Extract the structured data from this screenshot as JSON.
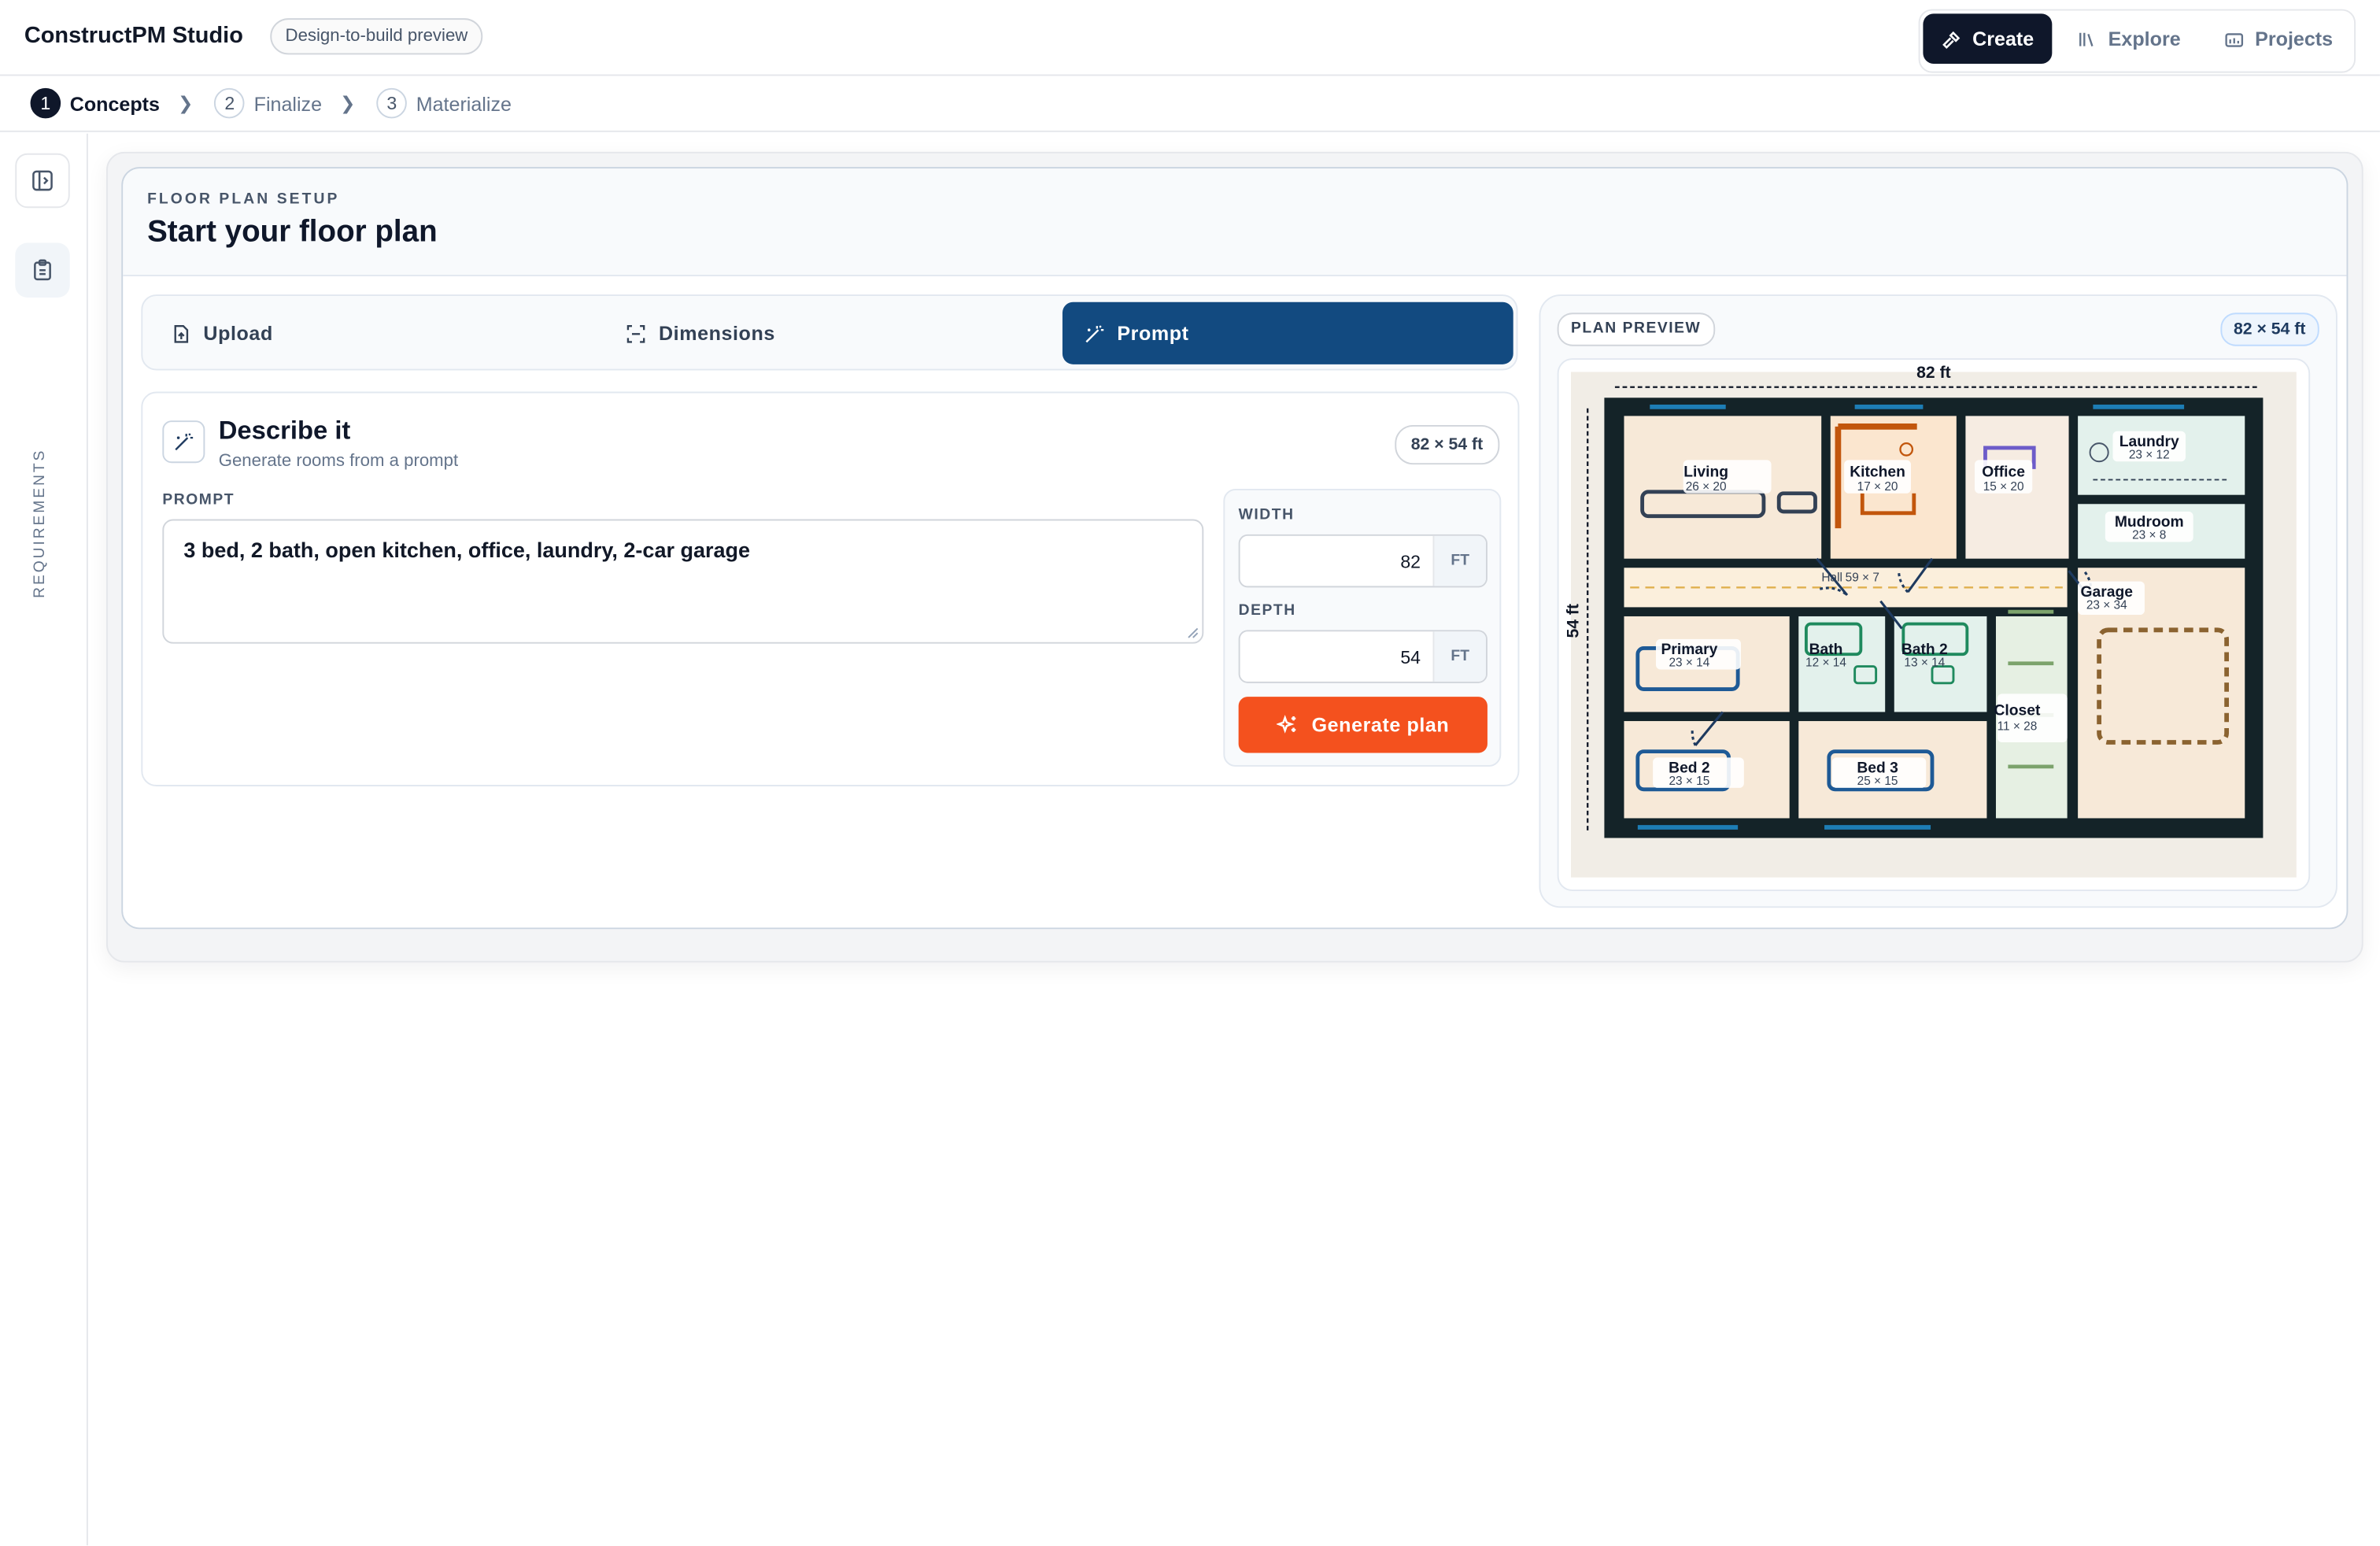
{
  "app": {
    "title": "ConstructPM Studio",
    "badge": "Design-to-build preview"
  },
  "nav": [
    {
      "label": "Create",
      "icon": "hammer-icon",
      "active": true
    },
    {
      "label": "Explore",
      "icon": "library-icon",
      "active": false
    },
    {
      "label": "Projects",
      "icon": "folder-icon",
      "active": false
    }
  ],
  "stepper": [
    {
      "num": "1",
      "label": "Concepts",
      "active": true
    },
    {
      "num": "2",
      "label": "Finalize",
      "active": false
    },
    {
      "num": "3",
      "label": "Materialize",
      "active": false
    }
  ],
  "rail": {
    "label": "REQUIREMENTS"
  },
  "setup": {
    "eyebrow": "FLOOR PLAN SETUP",
    "title": "Start your floor plan"
  },
  "tabs": [
    {
      "label": "Upload",
      "icon": "file-upload-icon"
    },
    {
      "label": "Dimensions",
      "icon": "scan-icon"
    },
    {
      "label": "Prompt",
      "icon": "magic-wand-icon",
      "active": true
    }
  ],
  "describe": {
    "title": "Describe it",
    "subtitle": "Generate rooms from a prompt",
    "chip": "82 × 54 ft",
    "prompt_label": "PROMPT",
    "prompt_value": "3 bed, 2 bath, open kitchen, office, laundry, 2-car garage"
  },
  "size": {
    "width_label": "WIDTH",
    "width_value": "82",
    "width_unit": "FT",
    "depth_label": "DEPTH",
    "depth_value": "54",
    "depth_unit": "FT",
    "generate_label": "Generate plan"
  },
  "preview": {
    "label": "PLAN PREVIEW",
    "chip": "82 × 54 ft",
    "width_dim": "82 ft",
    "depth_dim": "54 ft",
    "rooms": [
      {
        "name": "Living",
        "dims": "26 × 20"
      },
      {
        "name": "Kitchen",
        "dims": "17 × 20"
      },
      {
        "name": "Office",
        "dims": "15 × 20"
      },
      {
        "name": "Laundry",
        "dims": "23 × 12"
      },
      {
        "name": "Mudroom",
        "dims": "23 × 8"
      },
      {
        "name": "Hall",
        "dims": "59 × 7"
      },
      {
        "name": "Garage",
        "dims": "23 × 34"
      },
      {
        "name": "Primary",
        "dims": "23 × 14"
      },
      {
        "name": "Bath",
        "dims": "12 × 14"
      },
      {
        "name": "Bath 2",
        "dims": "13 × 14"
      },
      {
        "name": "Closet",
        "dims": "11 × 28"
      },
      {
        "name": "Bed 2",
        "dims": "23 × 15"
      },
      {
        "name": "Bed 3",
        "dims": "25 × 15"
      }
    ]
  },
  "colors": {
    "primary": "#124a80",
    "accent": "#f4511e",
    "dark": "#0f172a"
  }
}
